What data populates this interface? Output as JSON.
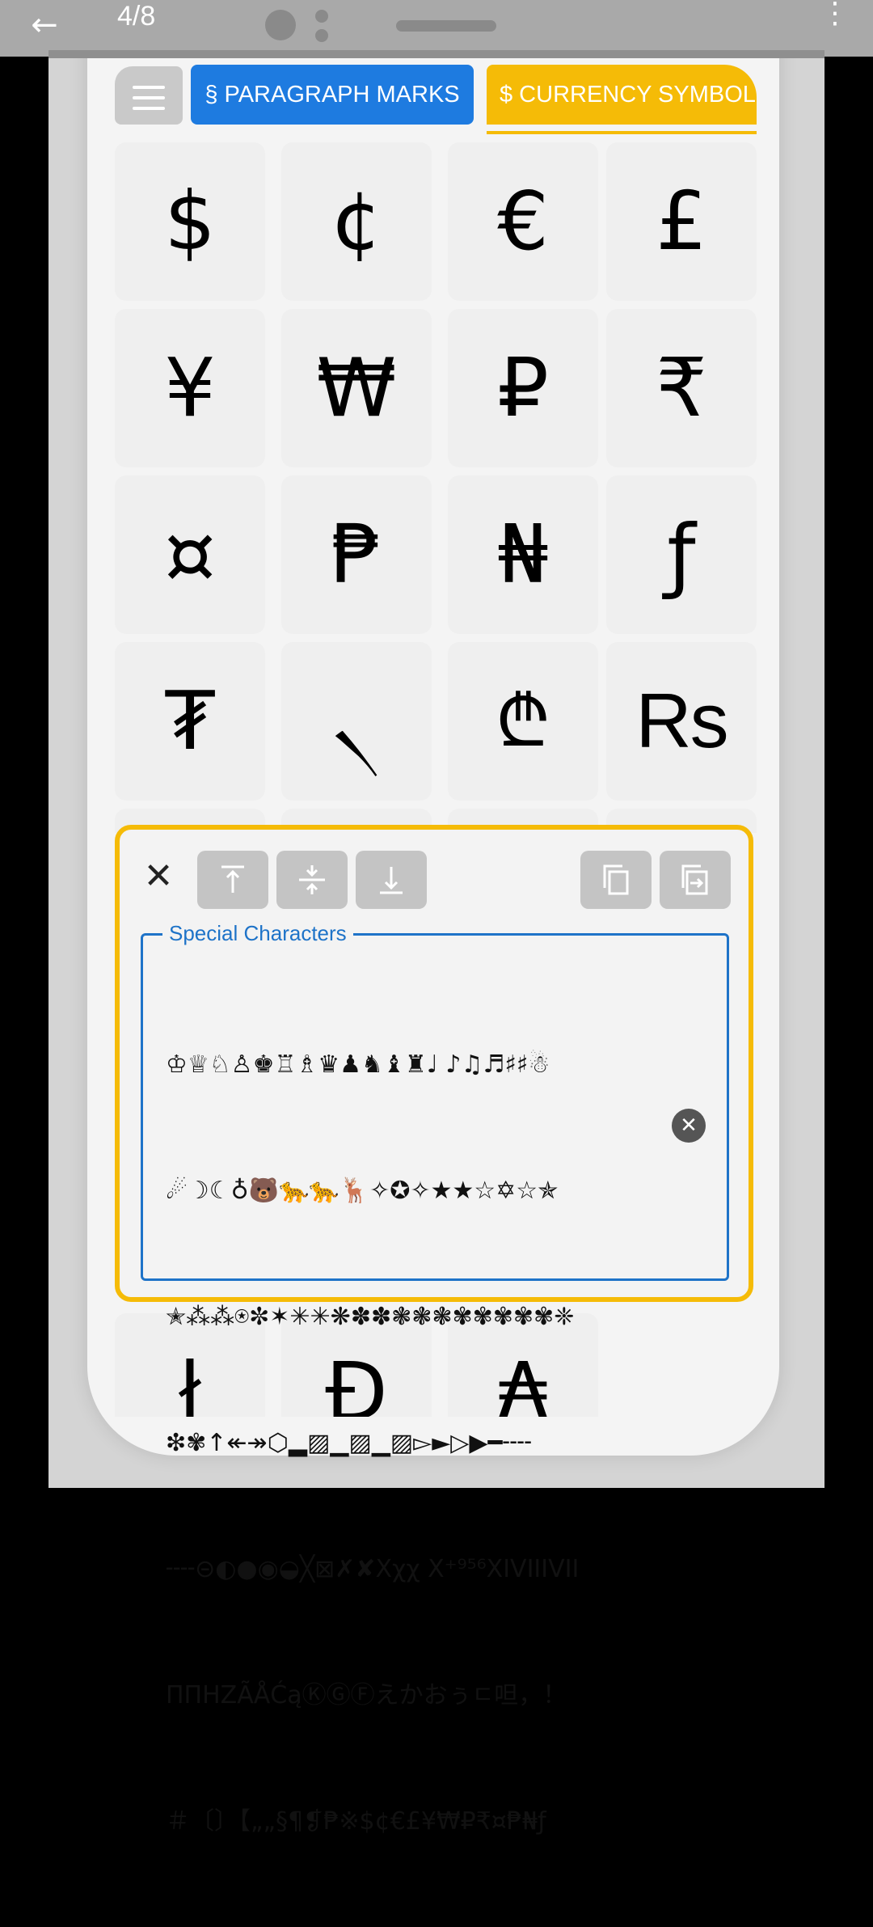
{
  "viewer": {
    "counter": "4/8",
    "back_icon": "←",
    "more_icon": "⋮"
  },
  "tabs": {
    "paragraph": "§ PARAGRAPH MARKS",
    "currency": "$ CURRENCY SYMBOL",
    "active_color": "#f5bb07",
    "inactive_color": "#1e7be0"
  },
  "grid": {
    "symbols": [
      "$",
      "¢",
      "€",
      "£",
      "¥",
      "₩",
      "₽",
      "₹",
      "¤",
      "₱",
      "₦",
      "ƒ",
      "₮",
      "৲",
      "₾",
      "Rs"
    ],
    "bottom_row": [
      "ł",
      "Đ",
      "₳"
    ]
  },
  "panel": {
    "close_icon": "✕",
    "field_label": "Special Characters",
    "field_lines": [
      "♔♕♘♙♚♖♗♛♟♞♝♜♩ ♪♫♬♯♯☃",
      "☄☽☾♁🐻🐆🐆🦌✧✪✧★★☆✡☆✯",
      "✭⁂⁂⍟✼✶✳✳❋✽✽❃❃❃✾✾✾✾✾❈",
      "❇✾↑↞↠⬡▂▨▁▨▁▨▻►▷▶━╌╌",
      "╌╌⊝◐●◉◒╳⊠✗✘Xχχ Χ⁺⁹⁵⁶XIVIIIVII",
      "ΠΠHZÃÅĆąⓀⒼⒻえかおぅㄷ呾，！",
      "＃〔〕【„„§¶❡₱※$¢€£¥₩₽₹¤₱₦ƒ"
    ],
    "clear_icon": "✕"
  }
}
